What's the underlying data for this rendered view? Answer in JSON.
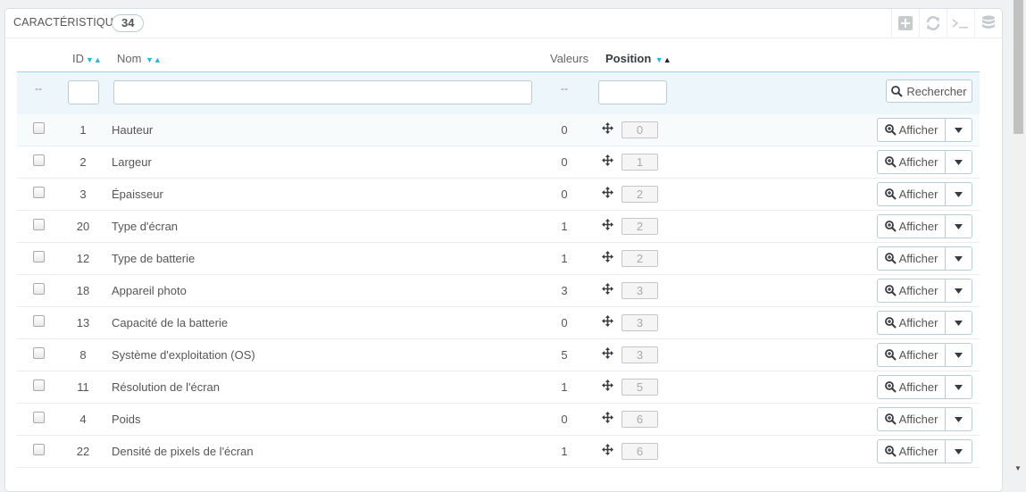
{
  "panel": {
    "title": "CARACTÉRISTIQUES",
    "count": "34",
    "tools": [
      "add-icon",
      "refresh-icon",
      "sql-icon",
      "database-icon"
    ]
  },
  "table": {
    "headers": {
      "id": "ID",
      "name": "Nom",
      "values": "Valeurs",
      "position": "Position"
    },
    "filter": {
      "dash_bulk": "--",
      "dash_values": "--",
      "search_label": "Rechercher"
    },
    "action_label": "Afficher",
    "rows": [
      {
        "id": "1",
        "name": "Hauteur",
        "values": "0",
        "position": "0"
      },
      {
        "id": "2",
        "name": "Largeur",
        "values": "0",
        "position": "1"
      },
      {
        "id": "3",
        "name": "Épaisseur",
        "values": "0",
        "position": "2"
      },
      {
        "id": "20",
        "name": "Type d'écran",
        "values": "1",
        "position": "2"
      },
      {
        "id": "12",
        "name": "Type de batterie",
        "values": "1",
        "position": "2"
      },
      {
        "id": "18",
        "name": "Appareil photo",
        "values": "3",
        "position": "3"
      },
      {
        "id": "13",
        "name": "Capacité de la batterie",
        "values": "0",
        "position": "3"
      },
      {
        "id": "8",
        "name": "Système d'exploitation (OS)",
        "values": "5",
        "position": "3"
      },
      {
        "id": "11",
        "name": "Résolution de l'écran",
        "values": "1",
        "position": "5"
      },
      {
        "id": "4",
        "name": "Poids",
        "values": "0",
        "position": "6"
      },
      {
        "id": "22",
        "name": "Densité de pixels de l'écran",
        "values": "1",
        "position": "6"
      }
    ]
  },
  "colors": {
    "accent": "#25b9d7",
    "filter_bg": "#ecf6fb"
  }
}
